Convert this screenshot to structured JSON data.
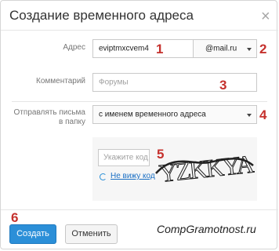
{
  "dialog": {
    "title": "Создание временного адреса",
    "close_icon": "close-icon"
  },
  "address": {
    "label": "Адрес",
    "value": "eviptmxcvem4",
    "domain": "@mail.ru"
  },
  "comment": {
    "label": "Комментарий",
    "placeholder": "Форумы"
  },
  "folder": {
    "label_line1": "Отправлять письма",
    "label_line2": "в папку",
    "selected": "с именем временного адреса"
  },
  "captcha": {
    "placeholder": "Укажите код",
    "refresh_label": "Не вижу код",
    "refresh_icon": "refresh-icon",
    "image_text": "YZKKYA"
  },
  "buttons": {
    "create": "Создать",
    "cancel": "Отменить"
  },
  "annotations": {
    "n1": "1",
    "n2": "2",
    "n3": "3",
    "n4": "4",
    "n5": "5",
    "n6": "6"
  },
  "watermark": "CompGramotnost.ru",
  "colors": {
    "primary_button": "#2b8fd8",
    "annotation": "#c5312d",
    "link": "#1a6fc4"
  }
}
